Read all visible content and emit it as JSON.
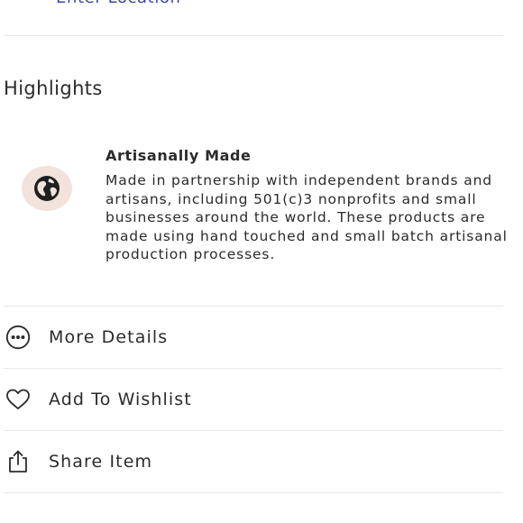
{
  "location": {
    "link_label": "Enter Location"
  },
  "highlights": {
    "heading": "Highlights",
    "items": [
      {
        "icon": "globe-icon",
        "title": "Artisanally Made",
        "description": "Made in partnership with independent brands and artisans, including 501(c)3 nonprofits and small businesses around the world. These products are made using hand touched and small batch artisanal production processes."
      }
    ]
  },
  "actions": [
    {
      "icon": "more-dots-icon",
      "label": "More Details"
    },
    {
      "icon": "heart-icon",
      "label": "Add To Wishlist"
    },
    {
      "icon": "share-icon",
      "label": "Share Item"
    }
  ],
  "colors": {
    "link": "#3b4aa3",
    "badge_bg": "#f1e3db",
    "text": "#2b2b2b",
    "divider": "#e8e8e8"
  }
}
